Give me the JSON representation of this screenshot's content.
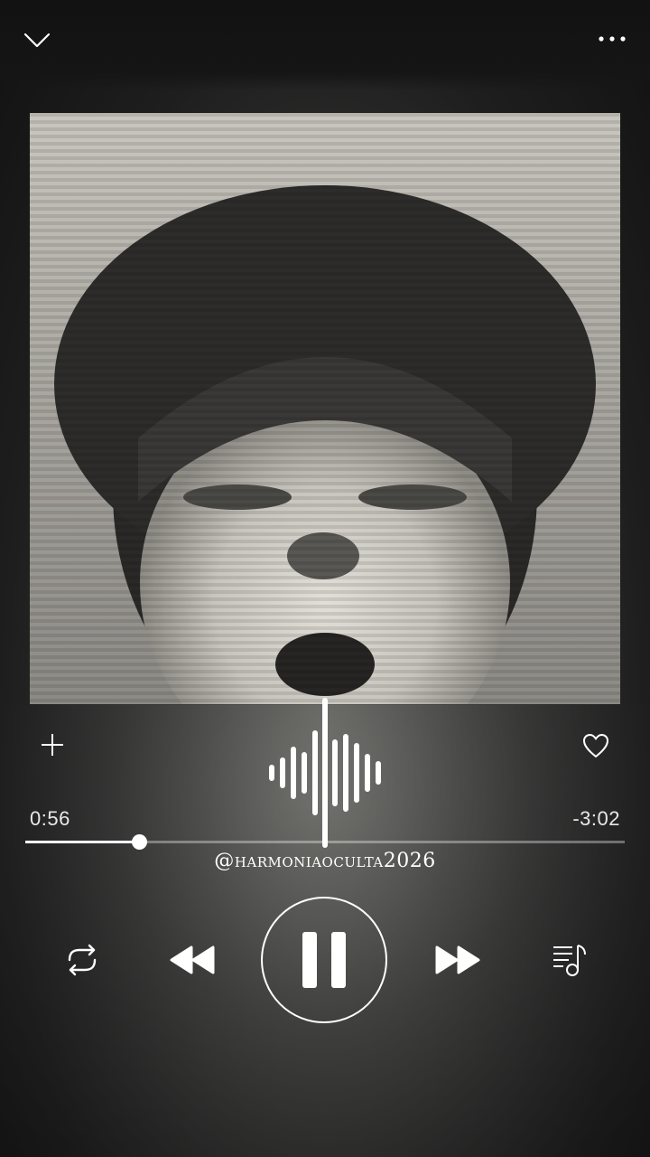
{
  "header": {
    "collapse_icon": "chevron-down-icon",
    "more_icon": "more-dots-icon"
  },
  "artwork": {
    "icon": "album-artwork-image"
  },
  "actions": {
    "add_icon": "plus-icon",
    "like_icon": "heart-icon",
    "waveform_icon": "sound-wave-icon"
  },
  "playback": {
    "elapsed": "0:56",
    "remaining": "-3:02",
    "progress_fraction": 0.19
  },
  "handle": "@harmoniaoculta2026",
  "controls": {
    "repeat_icon": "repeat-icon",
    "previous_icon": "rewind-icon",
    "pause_icon": "pause-icon",
    "next_icon": "fast-forward-icon",
    "queue_icon": "queue-icon"
  },
  "colors": {
    "background": "#121212",
    "foreground": "#ffffff",
    "track": "#7a7a7a"
  }
}
